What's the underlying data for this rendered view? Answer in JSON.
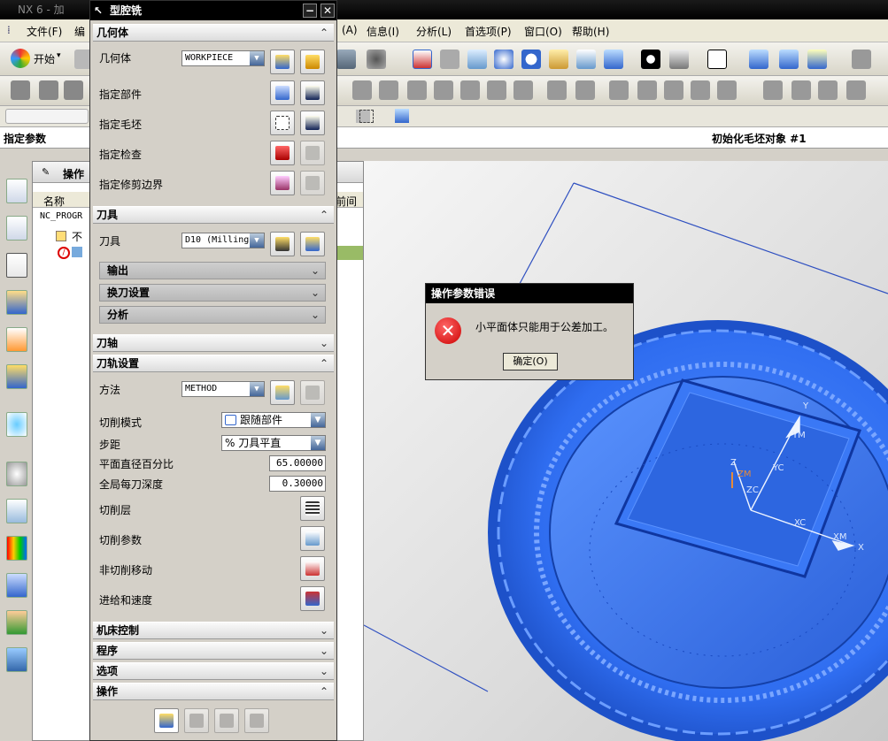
{
  "app": {
    "title": "NX 6 - 加"
  },
  "menubar": {
    "items": [
      "文件(F)",
      "编",
      "(A)",
      "信息(I)",
      "分析(L)",
      "首选项(P)",
      "窗口(O)",
      "帮助(H)"
    ]
  },
  "toolbar": {
    "start_label": "开始"
  },
  "cuebar": {
    "left_text": "指定参数",
    "right_text": "初始化毛坯对象 #1"
  },
  "navigator": {
    "tab_label": "操作",
    "col_name": "名称",
    "col_right": "前间",
    "row_program": "NC_PROGR",
    "row_child": "不",
    "icon_name": "no-entry-icon"
  },
  "op_dialog": {
    "title": "型腔铣",
    "sec_geometry": "几何体",
    "geometry_label": "几何体",
    "geometry_value": "WORKPIECE",
    "specify_part": "指定部件",
    "specify_blank": "指定毛坯",
    "specify_check": "指定检查",
    "specify_trim": "指定修剪边界",
    "sec_tool": "刀具",
    "tool_label": "刀具",
    "tool_value": "D10 (Milling",
    "sub_output": "输出",
    "sub_toolchange": "换刀设置",
    "sub_analysis": "分析",
    "sec_axis": "刀轴",
    "sec_path": "刀轨设置",
    "method_label": "方法",
    "method_value": "METHOD",
    "cutmode_label": "切削模式",
    "cutmode_value": "跟随部件",
    "stepover_label": "步距",
    "stepover_value": "% 刀具平直",
    "flatdia_label": "平面直径百分比",
    "flatdia_value": "65.00000",
    "depth_label": "全局每刀深度",
    "depth_value": "0.30000",
    "cutlevels_label": "切削层",
    "cutparams_label": "切削参数",
    "noncut_label": "非切削移动",
    "feeds_label": "进给和速度",
    "sec_machine": "机床控制",
    "sec_program": "程序",
    "sec_options": "选项",
    "sec_actions": "操作"
  },
  "error_dialog": {
    "title": "操作参数错误",
    "message": "小平面体只能用于公差加工。",
    "ok_label": "确定(O)"
  },
  "viewport": {
    "labels": {
      "y": "Y",
      "ym": "YM",
      "yc": "YC",
      "zm": "ZM",
      "zc": "ZC",
      "xc": "XC",
      "xm": "XM",
      "x": "X",
      "z": "Z"
    },
    "model_color": "#2f6df0"
  }
}
